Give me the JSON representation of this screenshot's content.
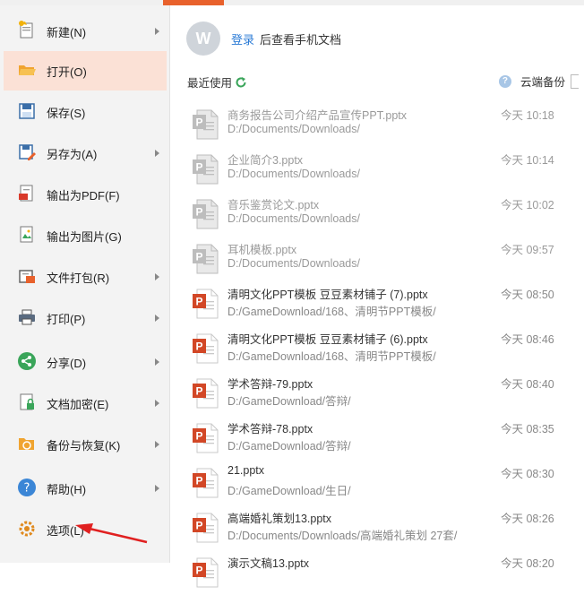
{
  "menu": {
    "items": [
      {
        "label": "新建(N)",
        "icon": "new-file-icon",
        "has_arrow": true
      },
      {
        "label": "打开(O)",
        "icon": "folder-open-icon",
        "has_arrow": false,
        "active": true
      },
      {
        "label": "保存(S)",
        "icon": "save-icon",
        "has_arrow": false
      },
      {
        "label": "另存为(A)",
        "icon": "save-as-icon",
        "has_arrow": true
      },
      {
        "label": "输出为PDF(F)",
        "icon": "pdf-export-icon",
        "has_arrow": false
      },
      {
        "label": "输出为图片(G)",
        "icon": "image-export-icon",
        "has_arrow": false
      },
      {
        "label": "文件打包(R)",
        "icon": "package-icon",
        "has_arrow": true
      },
      {
        "label": "打印(P)",
        "icon": "print-icon",
        "has_arrow": true
      },
      {
        "label": "分享(D)",
        "icon": "share-icon",
        "has_arrow": true
      },
      {
        "label": "文档加密(E)",
        "icon": "lock-icon",
        "has_arrow": true
      },
      {
        "label": "备份与恢复(K)",
        "icon": "backup-icon",
        "has_arrow": true
      },
      {
        "label": "帮助(H)",
        "icon": "help-icon",
        "has_arrow": true
      },
      {
        "label": "选项(L)",
        "icon": "gear-icon",
        "has_arrow": false
      }
    ]
  },
  "account": {
    "avatar_text": "W",
    "login_link": "登录",
    "login_suffix": "后查看手机文档"
  },
  "recent": {
    "title": "最近使用",
    "cloud_help": "?",
    "cloud_label": "云端备份"
  },
  "files": [
    {
      "name": "商务报告公司介绍产品宣传PPT.pptx",
      "path": "D:/Documents/Downloads/",
      "time": "今天 10:18",
      "style": "grey"
    },
    {
      "name": "企业简介3.pptx",
      "path": "D:/Documents/Downloads/",
      "time": "今天 10:14",
      "style": "grey"
    },
    {
      "name": "音乐鉴赏论文.pptx",
      "path": "D:/Documents/Downloads/",
      "time": "今天 10:02",
      "style": "grey"
    },
    {
      "name": "耳机模板.pptx",
      "path": "D:/Documents/Downloads/",
      "time": "今天 09:57",
      "style": "grey"
    },
    {
      "name": "清明文化PPT模板 豆豆素材铺子 (7).pptx",
      "path": "D:/GameDownload/168、清明节PPT模板/",
      "time": "今天 08:50",
      "style": "normal"
    },
    {
      "name": "清明文化PPT模板 豆豆素材铺子 (6).pptx",
      "path": "D:/GameDownload/168、清明节PPT模板/",
      "time": "今天 08:46",
      "style": "normal"
    },
    {
      "name": "学术答辩-79.pptx",
      "path": "D:/GameDownload/答辩/",
      "time": "今天 08:40",
      "style": "normal"
    },
    {
      "name": "学术答辩-78.pptx",
      "path": "D:/GameDownload/答辩/",
      "time": "今天 08:35",
      "style": "normal"
    },
    {
      "name": "21.pptx",
      "path": "D:/GameDownload/生日/",
      "time": "今天 08:30",
      "style": "normal"
    },
    {
      "name": "高端婚礼策划13.pptx",
      "path": "D:/Documents/Downloads/高端婚礼策划 27套/",
      "time": "今天 08:26",
      "style": "normal"
    },
    {
      "name": "演示文稿13.pptx",
      "path": "",
      "time": "今天 08:20",
      "style": "normal"
    }
  ],
  "colors": {
    "accent": "#e8612c",
    "active_bg": "#fbe1d6",
    "link": "#2b7bd6",
    "ppt_orange": "#d24726",
    "annotation_red": "#e02020"
  }
}
